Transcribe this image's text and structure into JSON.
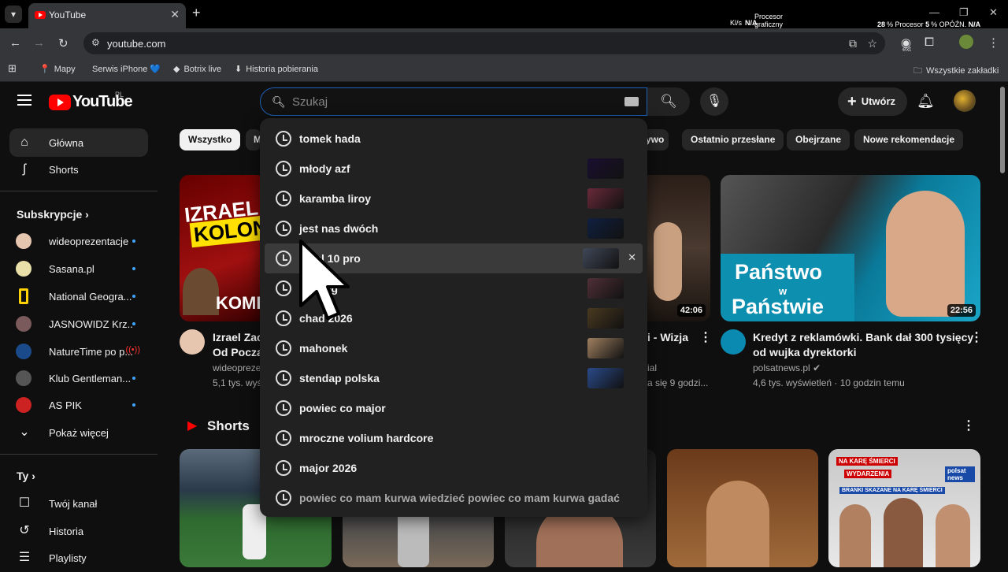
{
  "browser": {
    "tab_title": "YouTube",
    "new_tab": "+",
    "url": "youtube.com",
    "sys": {
      "kbs_label": "Kl/s",
      "kbs_value": "N/A",
      "gpu_label_1": "Procesor",
      "gpu_label_2": "graficzny",
      "cpu_value": "28",
      "cpu_unit": "%",
      "cpu_label": "Procesor",
      "lat_value": "5",
      "lat_unit": "%",
      "lat_label": "OPÓŹN.",
      "lat_na": "N/A"
    },
    "ext_badge": "ext",
    "bookmarks": [
      {
        "label": "Mapy",
        "icon": "maps-icon"
      },
      {
        "label": "Serwis iPhone 💙",
        "icon": "apple-icon"
      },
      {
        "label": "Botrix live",
        "icon": "botrix-icon"
      },
      {
        "label": "Historia pobierania",
        "icon": "download-icon"
      }
    ],
    "all_bookmarks": "Wszystkie zakładki"
  },
  "header": {
    "logo_text": "YouTube",
    "logo_region": "PL",
    "search_placeholder": "Szukaj",
    "create_label": "Utwórz"
  },
  "sidebar": {
    "main": [
      {
        "label": "Główna",
        "icon": "home-icon"
      },
      {
        "label": "Shorts",
        "icon": "shorts-icon"
      }
    ],
    "subs_title": "Subskrypcje",
    "subs": [
      {
        "label": "wideoprezentacje",
        "color": "#e7c6b0",
        "status": "dot"
      },
      {
        "label": "Sasana.pl",
        "color": "#e8e0a8",
        "status": "dot"
      },
      {
        "label": "National Geogra...",
        "color": "#ffd200",
        "status": "dot"
      },
      {
        "label": "JASNOWIDZ Krz...",
        "color": "#7a5a5a",
        "status": "dot"
      },
      {
        "label": "NatureTime po p...",
        "color": "#1a4a8a",
        "status": "live"
      },
      {
        "label": "Klub Gentleman...",
        "color": "#555555",
        "status": "dot"
      },
      {
        "label": "AS PIK",
        "color": "#cc2222",
        "status": "dot"
      }
    ],
    "show_more": "Pokaż więcej",
    "you_title": "Ty",
    "you": [
      {
        "label": "Twój kanał",
        "icon": "channel-icon"
      },
      {
        "label": "Historia",
        "icon": "history-icon"
      },
      {
        "label": "Playlisty",
        "icon": "playlist-icon"
      }
    ]
  },
  "chips": [
    "Wszystko",
    "M",
    "ywo",
    "Ostatnio przesłane",
    "Obejrzane",
    "Nowe rekomendacje"
  ],
  "videos": [
    {
      "title_1": "Izrael Zac",
      "title_2": "Od Począ",
      "channel": "wideoprezen",
      "meta": "5,1 tys. wyś",
      "thumb_text_1": "IZRAEL Z",
      "thumb_text_2": "KOLON",
      "thumb_text_3": "KOME"
    },
    {
      "title_1": "i - Wizja",
      "channel": "ial",
      "meta": "a się 9 godzi...",
      "duration": "42:06"
    },
    {
      "title_1": "Kredyt z reklamówki. Bank dał 300 tysięcy",
      "title_2": "od wujka dyrektorki",
      "channel": "polsatnews.pl",
      "meta": "4,6 tys. wyświetleń · 10 godzin temu",
      "duration": "22:56",
      "thumb_text_1": "Państwo",
      "thumb_text_2": "w",
      "thumb_text_3": "Państwie"
    }
  ],
  "shorts_title": "Shorts",
  "short_badges": {
    "wydarzenia": "WYDARZENIA",
    "polsat": "polsat news",
    "kara": "NA KARĘ ŚMIERCI",
    "skazane": "BRANKI SKAZANE NA KARĘ ŚMIERCI"
  },
  "suggestions": [
    {
      "text": "tomek hada",
      "thumb": false
    },
    {
      "text": "młody azf",
      "thumb": true,
      "color": "#1a1030"
    },
    {
      "text": "karamba liroy",
      "thumb": true,
      "color": "#6a2a3a"
    },
    {
      "text": "jest nas dwóch",
      "thumb": true,
      "color": "#102040"
    },
    {
      "text": "pixel 10 pro",
      "thumb": true,
      "color": "#404858",
      "highlight": true
    },
    {
      "text": "...ening",
      "thumb": true,
      "color": "#503038"
    },
    {
      "text": "chad 2026",
      "thumb": true,
      "color": "#4a3a20"
    },
    {
      "text": "mahonek",
      "thumb": true,
      "color": "#a08060"
    },
    {
      "text": "stendap polska",
      "thumb": true,
      "color": "#2a4a8a"
    },
    {
      "text": "powiec co major",
      "thumb": false
    },
    {
      "text": "mroczne volium hardcore",
      "thumb": false
    },
    {
      "text": "major 2026",
      "thumb": false
    },
    {
      "text": "powiec co mam kurwa wiedzieć powiec co mam kurwa gadać",
      "thumb": false,
      "dim": true
    }
  ],
  "remove_label": "✕",
  "colors": {
    "accent": "#ff0000",
    "focus": "#1c62b9",
    "bg": "#0f0f0f"
  }
}
